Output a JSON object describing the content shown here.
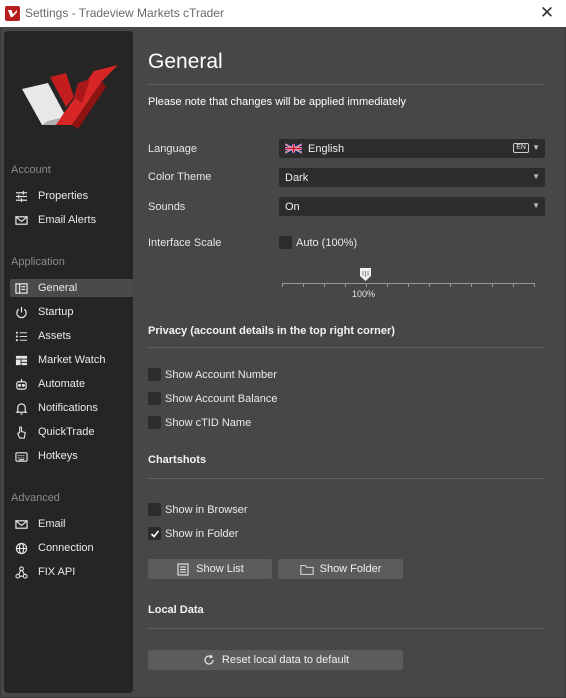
{
  "window": {
    "title": "Settings - Tradeview Markets cTrader"
  },
  "sidebar": {
    "sections": [
      {
        "label": "Account",
        "items": [
          {
            "label": "Properties",
            "icon": "sliders-icon"
          },
          {
            "label": "Email Alerts",
            "icon": "envelope-icon"
          }
        ]
      },
      {
        "label": "Application",
        "items": [
          {
            "label": "General",
            "icon": "layout-icon"
          },
          {
            "label": "Startup",
            "icon": "power-icon"
          },
          {
            "label": "Assets",
            "icon": "list-icon"
          },
          {
            "label": "Market Watch",
            "icon": "table-icon"
          },
          {
            "label": "Automate",
            "icon": "robot-icon"
          },
          {
            "label": "Notifications",
            "icon": "bell-icon"
          },
          {
            "label": "QuickTrade",
            "icon": "pointer-icon"
          },
          {
            "label": "Hotkeys",
            "icon": "keyboard-icon"
          }
        ]
      },
      {
        "label": "Advanced",
        "items": [
          {
            "label": "Email",
            "icon": "envelope-icon"
          },
          {
            "label": "Connection",
            "icon": "globe-icon"
          },
          {
            "label": "FIX API",
            "icon": "network-icon"
          }
        ]
      }
    ],
    "active": "General"
  },
  "main": {
    "title": "General",
    "note": "Please note that changes will be applied immediately",
    "language": {
      "label": "Language",
      "value": "English",
      "badge": "EN"
    },
    "color_theme": {
      "label": "Color Theme",
      "value": "Dark"
    },
    "sounds": {
      "label": "Sounds",
      "value": "On"
    },
    "interface_scale": {
      "label": "Interface Scale",
      "auto_label": "Auto (100%)",
      "auto_checked": false,
      "slider_value_label": "100%",
      "slider_value": 100
    },
    "privacy": {
      "title": "Privacy (account details in the top right corner)",
      "options": [
        {
          "label": "Show Account Number",
          "checked": false
        },
        {
          "label": "Show Account Balance",
          "checked": false
        },
        {
          "label": "Show cTID Name",
          "checked": false
        }
      ]
    },
    "chartshots": {
      "title": "Chartshots",
      "options": [
        {
          "label": "Show in Browser",
          "checked": false
        },
        {
          "label": "Show in Folder",
          "checked": true
        }
      ],
      "show_list_label": "Show List",
      "show_folder_label": "Show Folder"
    },
    "local_data": {
      "title": "Local Data",
      "reset_label": "Reset local data to default"
    }
  },
  "colors": {
    "brand_red": "#d42a2a",
    "background": "#474747",
    "sidebar": "#252525",
    "control": "#2c2c2c"
  }
}
